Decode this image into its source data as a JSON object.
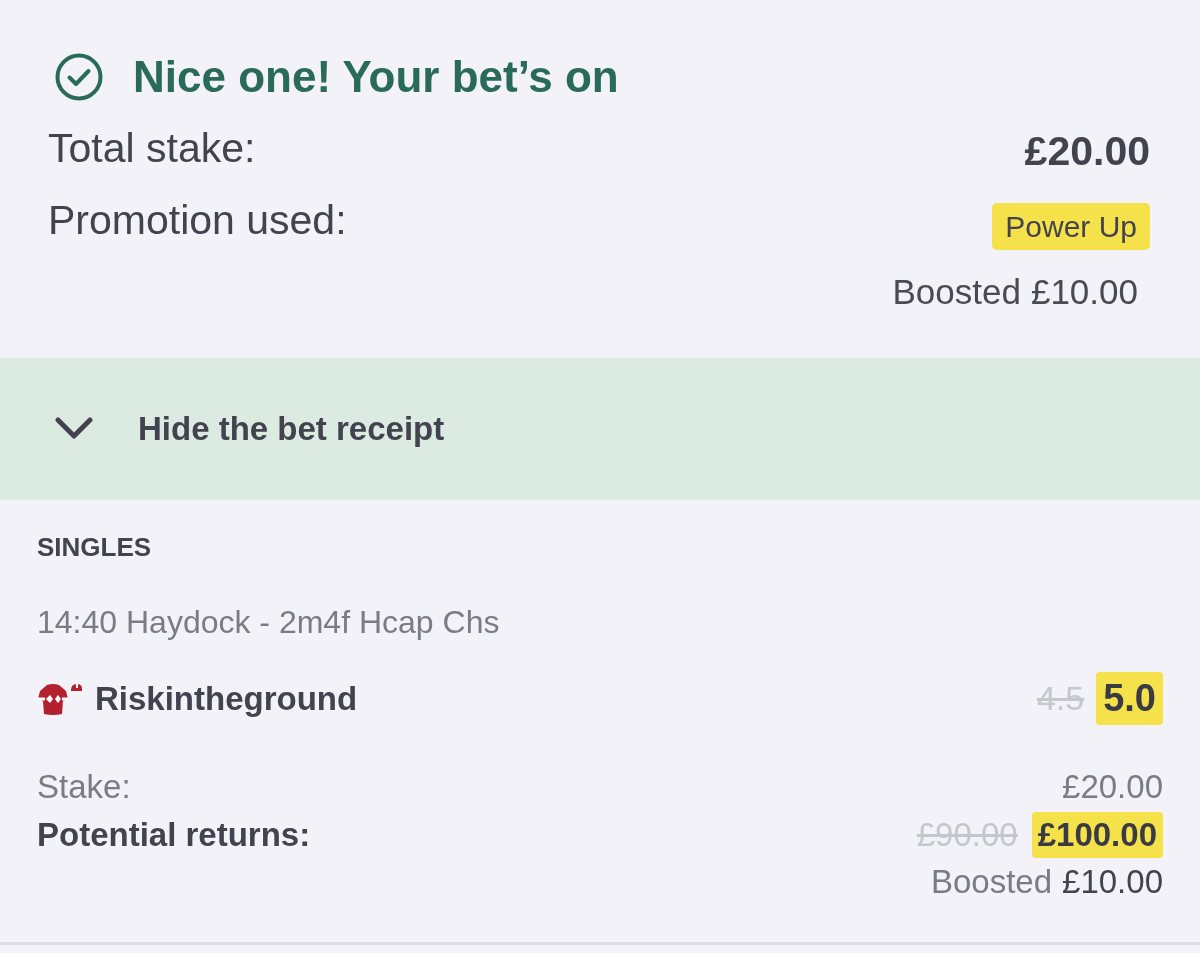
{
  "confirmation": {
    "title": "Nice one! Your bet’s on",
    "total_stake": {
      "label": "Total stake:",
      "value": "£20.00"
    },
    "promotion": {
      "label": "Promotion used:",
      "badge": "Power Up",
      "boost_label": "Boosted",
      "boost_value": "£10.00"
    }
  },
  "receipt_toggle": {
    "label": "Hide the bet receipt",
    "expanded": true
  },
  "receipt": {
    "section": "SINGLES",
    "event": "14:40 Haydock - 2m4f Hcap Chs",
    "selection": {
      "name": "Riskintheground",
      "old_odds": "4.5",
      "odds": "5.0"
    },
    "stake": {
      "label": "Stake:",
      "value": "£20.00"
    },
    "returns": {
      "label": "Potential returns:",
      "old_value": "£90.00",
      "value": "£100.00"
    },
    "boost": {
      "label": "Boosted",
      "value": "£10.00"
    }
  }
}
